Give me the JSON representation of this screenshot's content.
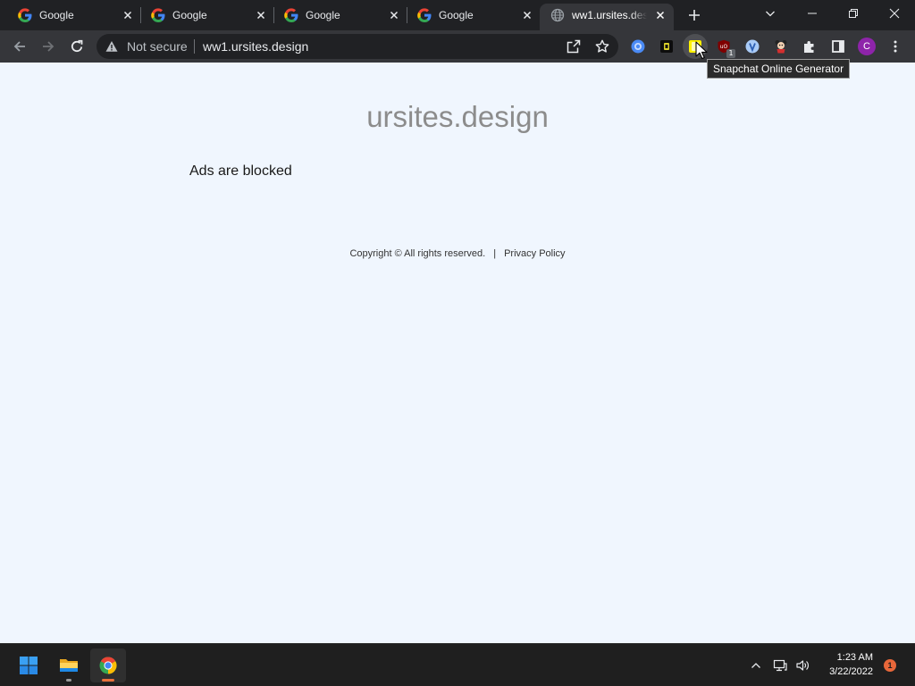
{
  "window": {
    "tabs": [
      {
        "label": "Google",
        "icon": "google-icon"
      },
      {
        "label": "Google",
        "icon": "google-icon"
      },
      {
        "label": "Google",
        "icon": "google-icon"
      },
      {
        "label": "Google",
        "icon": "google-icon"
      },
      {
        "label": "ww1.ursites.des",
        "icon": "globe-icon",
        "active": true
      }
    ],
    "new_tab_icon": "plus-icon",
    "controls": [
      "chevron-down-icon",
      "minimize-icon",
      "restore-icon",
      "close-icon"
    ]
  },
  "toolbar": {
    "nav_icons": [
      "back-arrow-icon",
      "forward-arrow-icon",
      "reload-icon"
    ],
    "security_label": "Not secure",
    "url": "ww1.ursites.design",
    "omnibox_icons": [
      "warning-icon",
      "share-icon",
      "star-icon"
    ],
    "extensions": [
      {
        "icon": "blue-circle-extension-icon"
      },
      {
        "icon": "dark-square-extension-icon"
      },
      {
        "icon": "snapchat-extension-icon",
        "hovered": true
      },
      {
        "icon": "ublock-origin-icon"
      },
      {
        "icon": "blue-badge-extension-icon"
      },
      {
        "icon": "character-extension-icon"
      }
    ],
    "ublock_badge": "1",
    "profile_initial": "C",
    "tooltip": "Snapchat Online Generator"
  },
  "page": {
    "site_title": "ursites.design",
    "message": "Ads are blocked",
    "footer": {
      "copyright": "Copyright © All rights reserved.",
      "separator": "|",
      "privacy_link": "Privacy Policy"
    }
  },
  "taskbar": {
    "apps": [
      "windows-logo-icon",
      "file-explorer-icon",
      "chrome-icon"
    ],
    "tray_icons": [
      "chevron-up-icon",
      "network-icon",
      "volume-icon"
    ],
    "time": "1:23 AM",
    "date": "3/22/2022",
    "notification_count": "1"
  },
  "colors": {
    "browser_frame": "#202124",
    "toolbar": "#35363a",
    "page_background": "#f0f6fe",
    "site_title": "#8c8c8c",
    "profile_avatar": "#8e24aa",
    "notification_badge": "#e8673a"
  }
}
